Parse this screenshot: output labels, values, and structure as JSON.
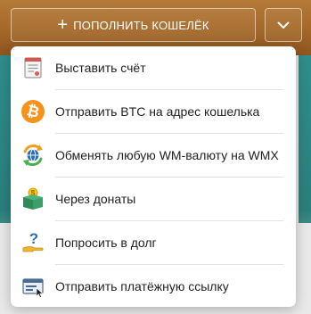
{
  "header": {
    "fill_wallet_label": "ПОПОЛНИТЬ КОШЕЛЁК",
    "plus_symbol": "+",
    "dropdown_icon": "chevron-down-icon"
  },
  "menu": {
    "items": [
      {
        "label": "Выставить счёт",
        "icon": "invoice-icon"
      },
      {
        "label": "Отправить BTC на адрес кошелька",
        "icon": "bitcoin-icon"
      },
      {
        "label": "Обменять любую WM-валюту на WMX",
        "icon": "exchange-globe-icon"
      },
      {
        "label": "Через донаты",
        "icon": "gift-box-icon"
      },
      {
        "label": "Попросить в долг",
        "icon": "ask-loan-icon"
      },
      {
        "label": "Отправить платёжную ссылку",
        "icon": "payment-link-icon"
      }
    ]
  },
  "colors": {
    "header_brown": "#a86b2a",
    "bitcoin_orange": "#f7931a",
    "teal": "#2f8e8b"
  }
}
